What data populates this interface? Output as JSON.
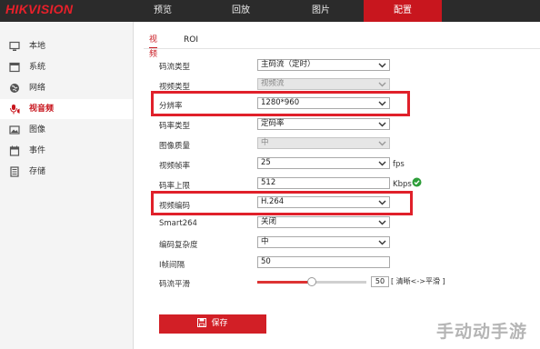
{
  "brand": {
    "logo": "HIKVISION"
  },
  "nav": {
    "items": [
      {
        "label": "预览"
      },
      {
        "label": "回放"
      },
      {
        "label": "图片"
      },
      {
        "label": "配置"
      }
    ],
    "active": "配置"
  },
  "sidebar": {
    "items": [
      {
        "label": "本地",
        "icon": "monitor-icon"
      },
      {
        "label": "系统",
        "icon": "window-icon"
      },
      {
        "label": "网络",
        "icon": "globe-icon"
      },
      {
        "label": "视音频",
        "icon": "audio-video-icon"
      },
      {
        "label": "图像",
        "icon": "image-icon"
      },
      {
        "label": "事件",
        "icon": "calendar-icon"
      },
      {
        "label": "存储",
        "icon": "storage-icon"
      }
    ],
    "active": "视音频"
  },
  "tabs": [
    {
      "label": "视频"
    },
    {
      "label": "ROI"
    }
  ],
  "form": {
    "stream_type": {
      "label": "码流类型",
      "value": "主码流（定时）"
    },
    "video_type": {
      "label": "视频类型",
      "value": "视频流"
    },
    "resolution": {
      "label": "分辨率",
      "value": "1280*960"
    },
    "bitrate_type": {
      "label": "码率类型",
      "value": "定码率"
    },
    "image_quality": {
      "label": "图像质量",
      "value": "中"
    },
    "frame_rate": {
      "label": "视频帧率",
      "value": "25",
      "unit": "fps"
    },
    "max_bitrate": {
      "label": "码率上限",
      "value": "512",
      "unit": "Kbps"
    },
    "video_encoding": {
      "label": "视频编码",
      "value": "H.264"
    },
    "smart264": {
      "label": "Smart264",
      "value": "关闭"
    },
    "encoding_complexity": {
      "label": "编码复杂度",
      "value": "中"
    },
    "i_frame_interval": {
      "label": "I帧间隔",
      "value": "50"
    },
    "bitrate_smoothing": {
      "label": "码流平滑",
      "value": "50",
      "hint": "[ 清晰<->平滑 ]",
      "level_percent": 50
    }
  },
  "actions": {
    "save_label": "保存"
  },
  "watermark": "手动动手游",
  "colors": {
    "accent": "#c8161e",
    "highlight": "#e0202a",
    "topbar": "#2b2b2b",
    "ok": "#2e9e3a"
  }
}
